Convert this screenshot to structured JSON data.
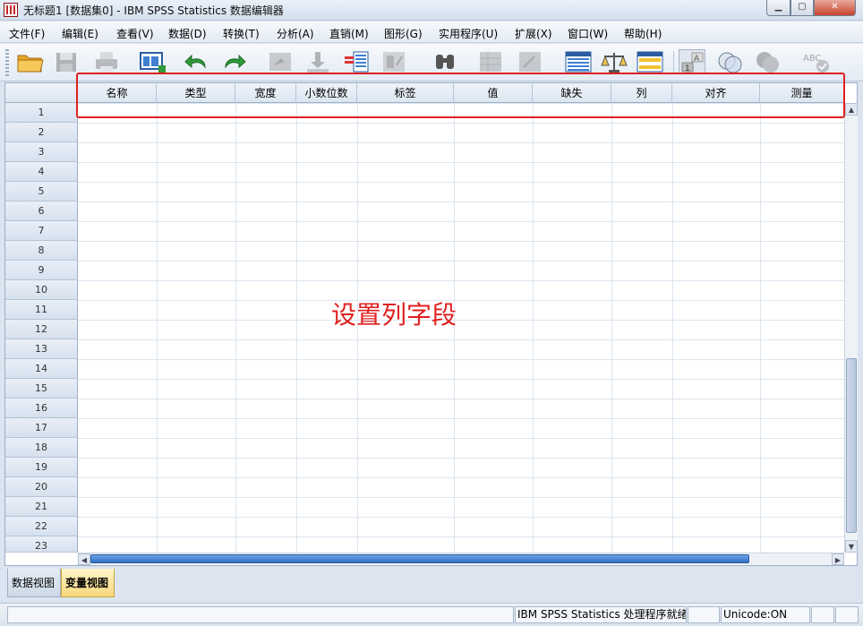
{
  "window": {
    "title": "无标题1 [数据集0] - IBM SPSS Statistics 数据编辑器"
  },
  "menu": [
    "文件(F)",
    "编辑(E)",
    "查看(V)",
    "数据(D)",
    "转换(T)",
    "分析(A)",
    "直销(M)",
    "图形(G)",
    "实用程序(U)",
    "扩展(X)",
    "窗口(W)",
    "帮助(H)"
  ],
  "toolbar_icons": [
    "open-folder-icon",
    "save-icon",
    "print-icon",
    "recall-dialog-icon",
    "undo-icon",
    "redo-icon",
    "goto-case-icon",
    "goto-variable-icon",
    "variables-icon",
    "run-descriptives-icon",
    "find-icon",
    "insert-cases-icon",
    "insert-variable-icon",
    "split-file-icon",
    "weight-cases-icon",
    "select-cases-icon",
    "value-labels-icon",
    "use-sets-icon",
    "show-all-variables-icon",
    "spell-check-icon"
  ],
  "columns": [
    "名称",
    "类型",
    "宽度",
    "小数位数",
    "标签",
    "值",
    "缺失",
    "列",
    "对齐",
    "测量"
  ],
  "rows": [
    "1",
    "2",
    "3",
    "4",
    "5",
    "6",
    "7",
    "8",
    "9",
    "10",
    "11",
    "12",
    "13",
    "14",
    "15",
    "16",
    "17",
    "18",
    "19",
    "20",
    "21",
    "22",
    "23"
  ],
  "annotation": {
    "text": "设置列字段",
    "color": "#e02020"
  },
  "tabs": {
    "data_view": "数据视图",
    "variable_view": "变量视图",
    "active": "variable_view"
  },
  "status": {
    "processor": "IBM SPSS Statistics 处理程序就绪",
    "unicode": "Unicode:ON"
  }
}
